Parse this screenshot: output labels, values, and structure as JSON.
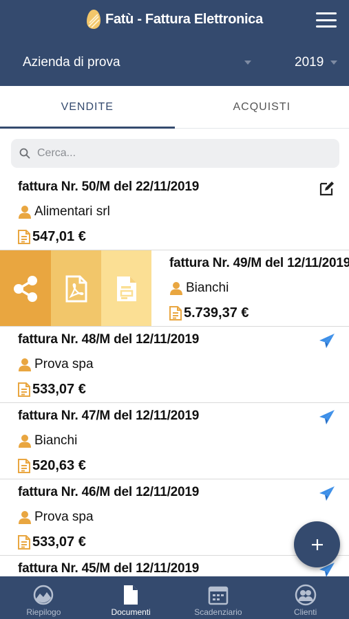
{
  "header": {
    "app_title": "Fatù - Fattura Elettronica",
    "company": "Azienda di prova",
    "year": "2019"
  },
  "tabs": [
    {
      "label": "VENDITE",
      "active": true
    },
    {
      "label": "ACQUISTI",
      "active": false
    }
  ],
  "search": {
    "placeholder": "Cerca..."
  },
  "invoices": [
    {
      "title": "fattura Nr. 50/M del 22/11/2019",
      "client": "Alimentari srl",
      "amount": "547,01 €",
      "action_icon": "edit-icon"
    },
    {
      "title": "fattura Nr. 49/M del 12/11/2019",
      "client": "Bianchi",
      "amount": "5.739,37 €",
      "action_icon": "none",
      "swiped": true
    },
    {
      "title": "fattura Nr. 48/M del 12/11/2019",
      "client": "Prova spa",
      "amount": "533,07 €",
      "action_icon": "send-icon"
    },
    {
      "title": "fattura Nr. 47/M del 12/11/2019",
      "client": "Bianchi",
      "amount": "520,63 €",
      "action_icon": "send-icon"
    },
    {
      "title": "fattura Nr. 46/M del 12/11/2019",
      "client": "Prova spa",
      "amount": "533,07 €",
      "action_icon": "send-icon"
    },
    {
      "title": "fattura Nr. 45/M del 12/11/2019",
      "client": "",
      "amount": "",
      "action_icon": "send-icon"
    }
  ],
  "swipe_actions": [
    "share-icon",
    "pdf-icon",
    "xml-doc-icon"
  ],
  "nav": [
    {
      "label": "Riepilogo",
      "icon": "dashboard-icon",
      "active": false
    },
    {
      "label": "Documenti",
      "icon": "document-icon",
      "active": true
    },
    {
      "label": "Scadenziario",
      "icon": "calendar-icon",
      "active": false
    },
    {
      "label": "Clienti",
      "icon": "clients-icon",
      "active": false
    }
  ],
  "colors": {
    "primary": "#344a6e",
    "accent": "#e9a640",
    "send_blue": "#3d8fe8"
  }
}
